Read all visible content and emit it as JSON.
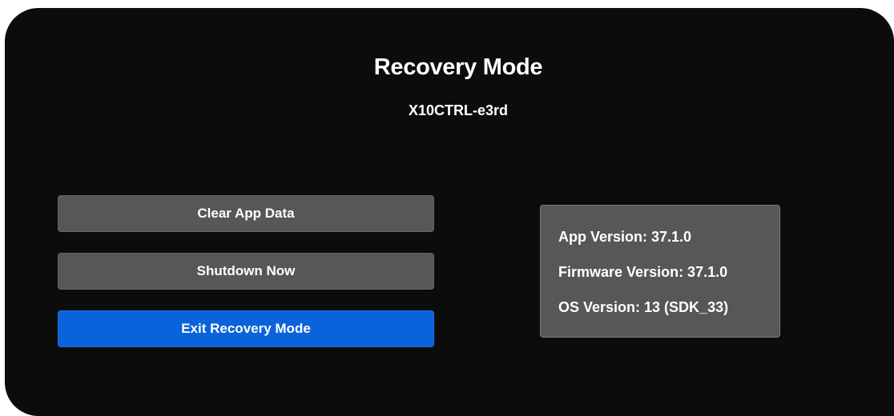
{
  "header": {
    "title": "Recovery Mode",
    "device_id": "X10CTRL-e3rd"
  },
  "actions": {
    "clear_app_data_label": "Clear App Data",
    "shutdown_label": "Shutdown Now",
    "exit_recovery_label": "Exit Recovery Mode"
  },
  "info": {
    "app_version": "App Version: 37.1.0",
    "firmware_version": "Firmware Version: 37.1.0",
    "os_version": "OS Version: 13 (SDK_33)"
  },
  "colors": {
    "background": "#0c0c0c",
    "button_gray": "#575757",
    "button_primary": "#0a63db",
    "text": "#ffffff"
  }
}
